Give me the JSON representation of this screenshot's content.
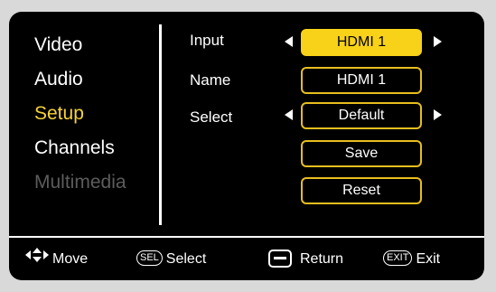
{
  "menu": {
    "items": [
      {
        "label": "Video",
        "state": "normal"
      },
      {
        "label": "Audio",
        "state": "normal"
      },
      {
        "label": "Setup",
        "state": "active"
      },
      {
        "label": "Channels",
        "state": "normal"
      },
      {
        "label": "Multimedia",
        "state": "disabled"
      }
    ]
  },
  "settings": {
    "input": {
      "label": "Input",
      "value": "HDMI 1"
    },
    "name": {
      "label": "Name",
      "value": "HDMI 1"
    },
    "select": {
      "label": "Select",
      "value": "Default"
    },
    "save_label": "Save",
    "reset_label": "Reset"
  },
  "footer": {
    "move": {
      "icon": "four-way-arrow-icon",
      "label": "Move"
    },
    "select": {
      "key": "SEL",
      "label": "Select"
    },
    "return": {
      "icon": "minus-key-icon",
      "label": "Return"
    },
    "exit": {
      "key": "EXIT",
      "label": "Exit"
    }
  },
  "colors": {
    "accent": "#f7d218",
    "border": "#e8be1e",
    "background": "#000000",
    "disabled": "#5c5c5c"
  }
}
